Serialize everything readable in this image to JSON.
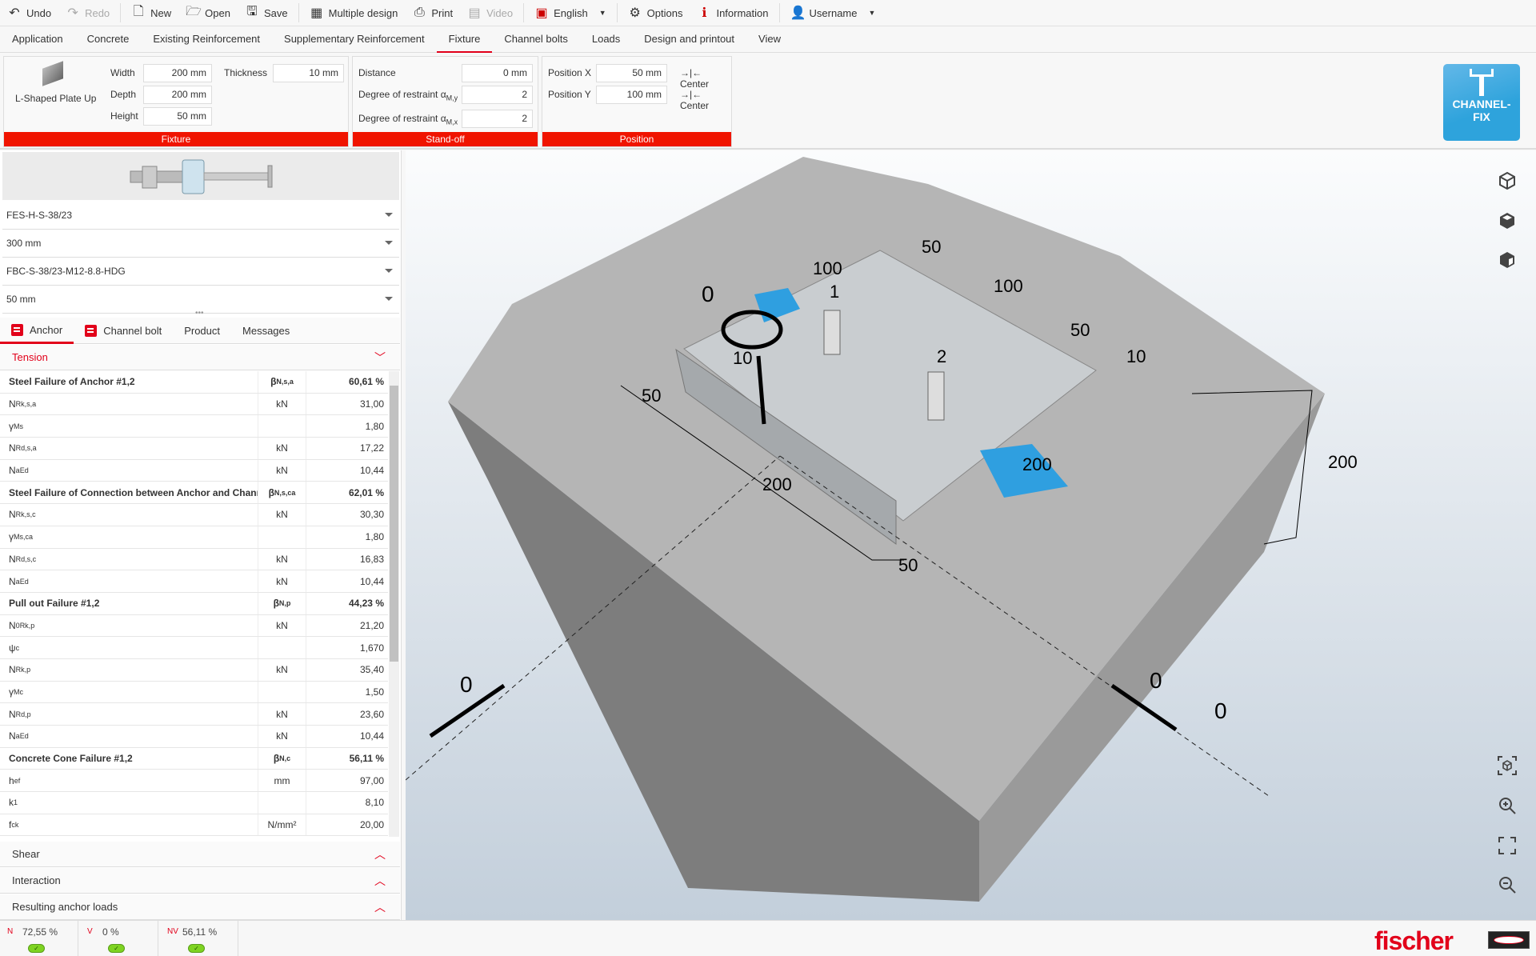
{
  "toolbar": {
    "undo": "Undo",
    "redo": "Redo",
    "new": "New",
    "open": "Open",
    "save": "Save",
    "multiple_design": "Multiple design",
    "print": "Print",
    "video": "Video",
    "language": "English",
    "options": "Options",
    "information": "Information",
    "user": "Username"
  },
  "tabs": [
    "Application",
    "Concrete",
    "Existing Reinforcement",
    "Supplementary Reinforcement",
    "Fixture",
    "Channel bolts",
    "Loads",
    "Design and printout",
    "View"
  ],
  "active_tab": "Fixture",
  "ribbon": {
    "fixture": {
      "title": "Fixture",
      "type": "L-Shaped Plate Up",
      "width_label": "Width",
      "width": "200 mm",
      "depth_label": "Depth",
      "depth": "200 mm",
      "height_label": "Height",
      "height": "50 mm",
      "thickness_label": "Thickness",
      "thickness": "10 mm"
    },
    "standoff": {
      "title": "Stand-off",
      "distance_label": "Distance",
      "distance": "0 mm",
      "restraint_y_label": "Degree of restraint α",
      "restraint_y_sub": "M,y",
      "restraint_y": "2",
      "restraint_x_label": "Degree of restraint α",
      "restraint_x_sub": "M,x",
      "restraint_x": "2"
    },
    "position": {
      "title": "Position",
      "x_label": "Position X",
      "x": "50 mm",
      "y_label": "Position Y",
      "y": "100 mm",
      "center": "Center"
    },
    "channelfix": {
      "line1": "CHANNEL-",
      "line2": "FIX"
    }
  },
  "left": {
    "dropdowns": [
      "FES-H-S-38/23",
      "300 mm",
      "FBC-S-38/23-M12-8.8-HDG",
      "50 mm"
    ],
    "result_tabs": [
      "Anchor",
      "Channel bolt",
      "Product",
      "Messages"
    ],
    "tension": "Tension",
    "rows": [
      {
        "m": "Steel Failure of Anchor #1,2",
        "u": "β",
        "us": "N,s,a",
        "v": "60,61 %",
        "b": true
      },
      {
        "m": "N",
        "sub": "Rk,s,a",
        "u": "kN",
        "v": "31,00"
      },
      {
        "m": "γ",
        "sub": "Ms",
        "u": "",
        "v": "1,80"
      },
      {
        "m": "N",
        "sub": "Rd,s,a",
        "u": "kN",
        "v": "17,22"
      },
      {
        "m": "N",
        "sup": "a",
        "sub": "Ed",
        "u": "kN",
        "v": "10,44"
      },
      {
        "m": "Steel Failure of Connection between Anchor and Chann...",
        "u": "β",
        "us": "N,s,ca",
        "v": "62,01 %",
        "b": true
      },
      {
        "m": "N",
        "sub": "Rk,s,c",
        "u": "kN",
        "v": "30,30"
      },
      {
        "m": "γ",
        "sub": "Ms,ca",
        "u": "",
        "v": "1,80"
      },
      {
        "m": "N",
        "sub": "Rd,s,c",
        "u": "kN",
        "v": "16,83"
      },
      {
        "m": "N",
        "sup": "a",
        "sub": "Ed",
        "u": "kN",
        "v": "10,44"
      },
      {
        "m": "Pull out Failure #1,2",
        "u": "β",
        "us": "N,p",
        "v": "44,23 %",
        "b": true
      },
      {
        "m": "N",
        "sup": "0",
        "sub": "Rk,p",
        "u": "kN",
        "v": "21,20"
      },
      {
        "m": "ψ",
        "sub": "c",
        "u": "",
        "v": "1,670"
      },
      {
        "m": "N",
        "sub": "Rk,p",
        "u": "kN",
        "v": "35,40"
      },
      {
        "m": "γ",
        "sub": "Mc",
        "u": "",
        "v": "1,50"
      },
      {
        "m": "N",
        "sub": "Rd,p",
        "u": "kN",
        "v": "23,60"
      },
      {
        "m": "N",
        "sup": "a",
        "sub": "Ed",
        "u": "kN",
        "v": "10,44"
      },
      {
        "m": "Concrete Cone Failure #1,2",
        "u": "β",
        "us": "N,c",
        "v": "56,11 %",
        "b": true
      },
      {
        "m": "h",
        "sub": "ef",
        "u": "mm",
        "v": "97,00"
      },
      {
        "m": "k",
        "sub": "1",
        "u": "",
        "v": "8,10"
      },
      {
        "m": "f",
        "sub": "ck",
        "u": "N/mm²",
        "v": "20,00"
      }
    ],
    "sections": [
      "Shear",
      "Interaction",
      "Resulting anchor loads"
    ]
  },
  "status": [
    {
      "icon": "N",
      "value": "72,55 %"
    },
    {
      "icon": "V",
      "value": "0 %"
    },
    {
      "icon": "NV",
      "value": "56,11 %"
    }
  ],
  "viewport": {
    "labels": [
      "0",
      "100",
      "50",
      "100",
      "50",
      "10",
      "1",
      "2",
      "10",
      "50",
      "200",
      "200",
      "50",
      "200",
      "0",
      "0",
      "0"
    ]
  },
  "brand": {
    "logo": "fischer",
    "color": "#e2001a"
  },
  "colors": {
    "accent": "#e2001a",
    "group_bar": "#f01400",
    "channelfix": "#2ea3dc",
    "channel": "#2f9fe0",
    "ok": "#7ed321"
  }
}
